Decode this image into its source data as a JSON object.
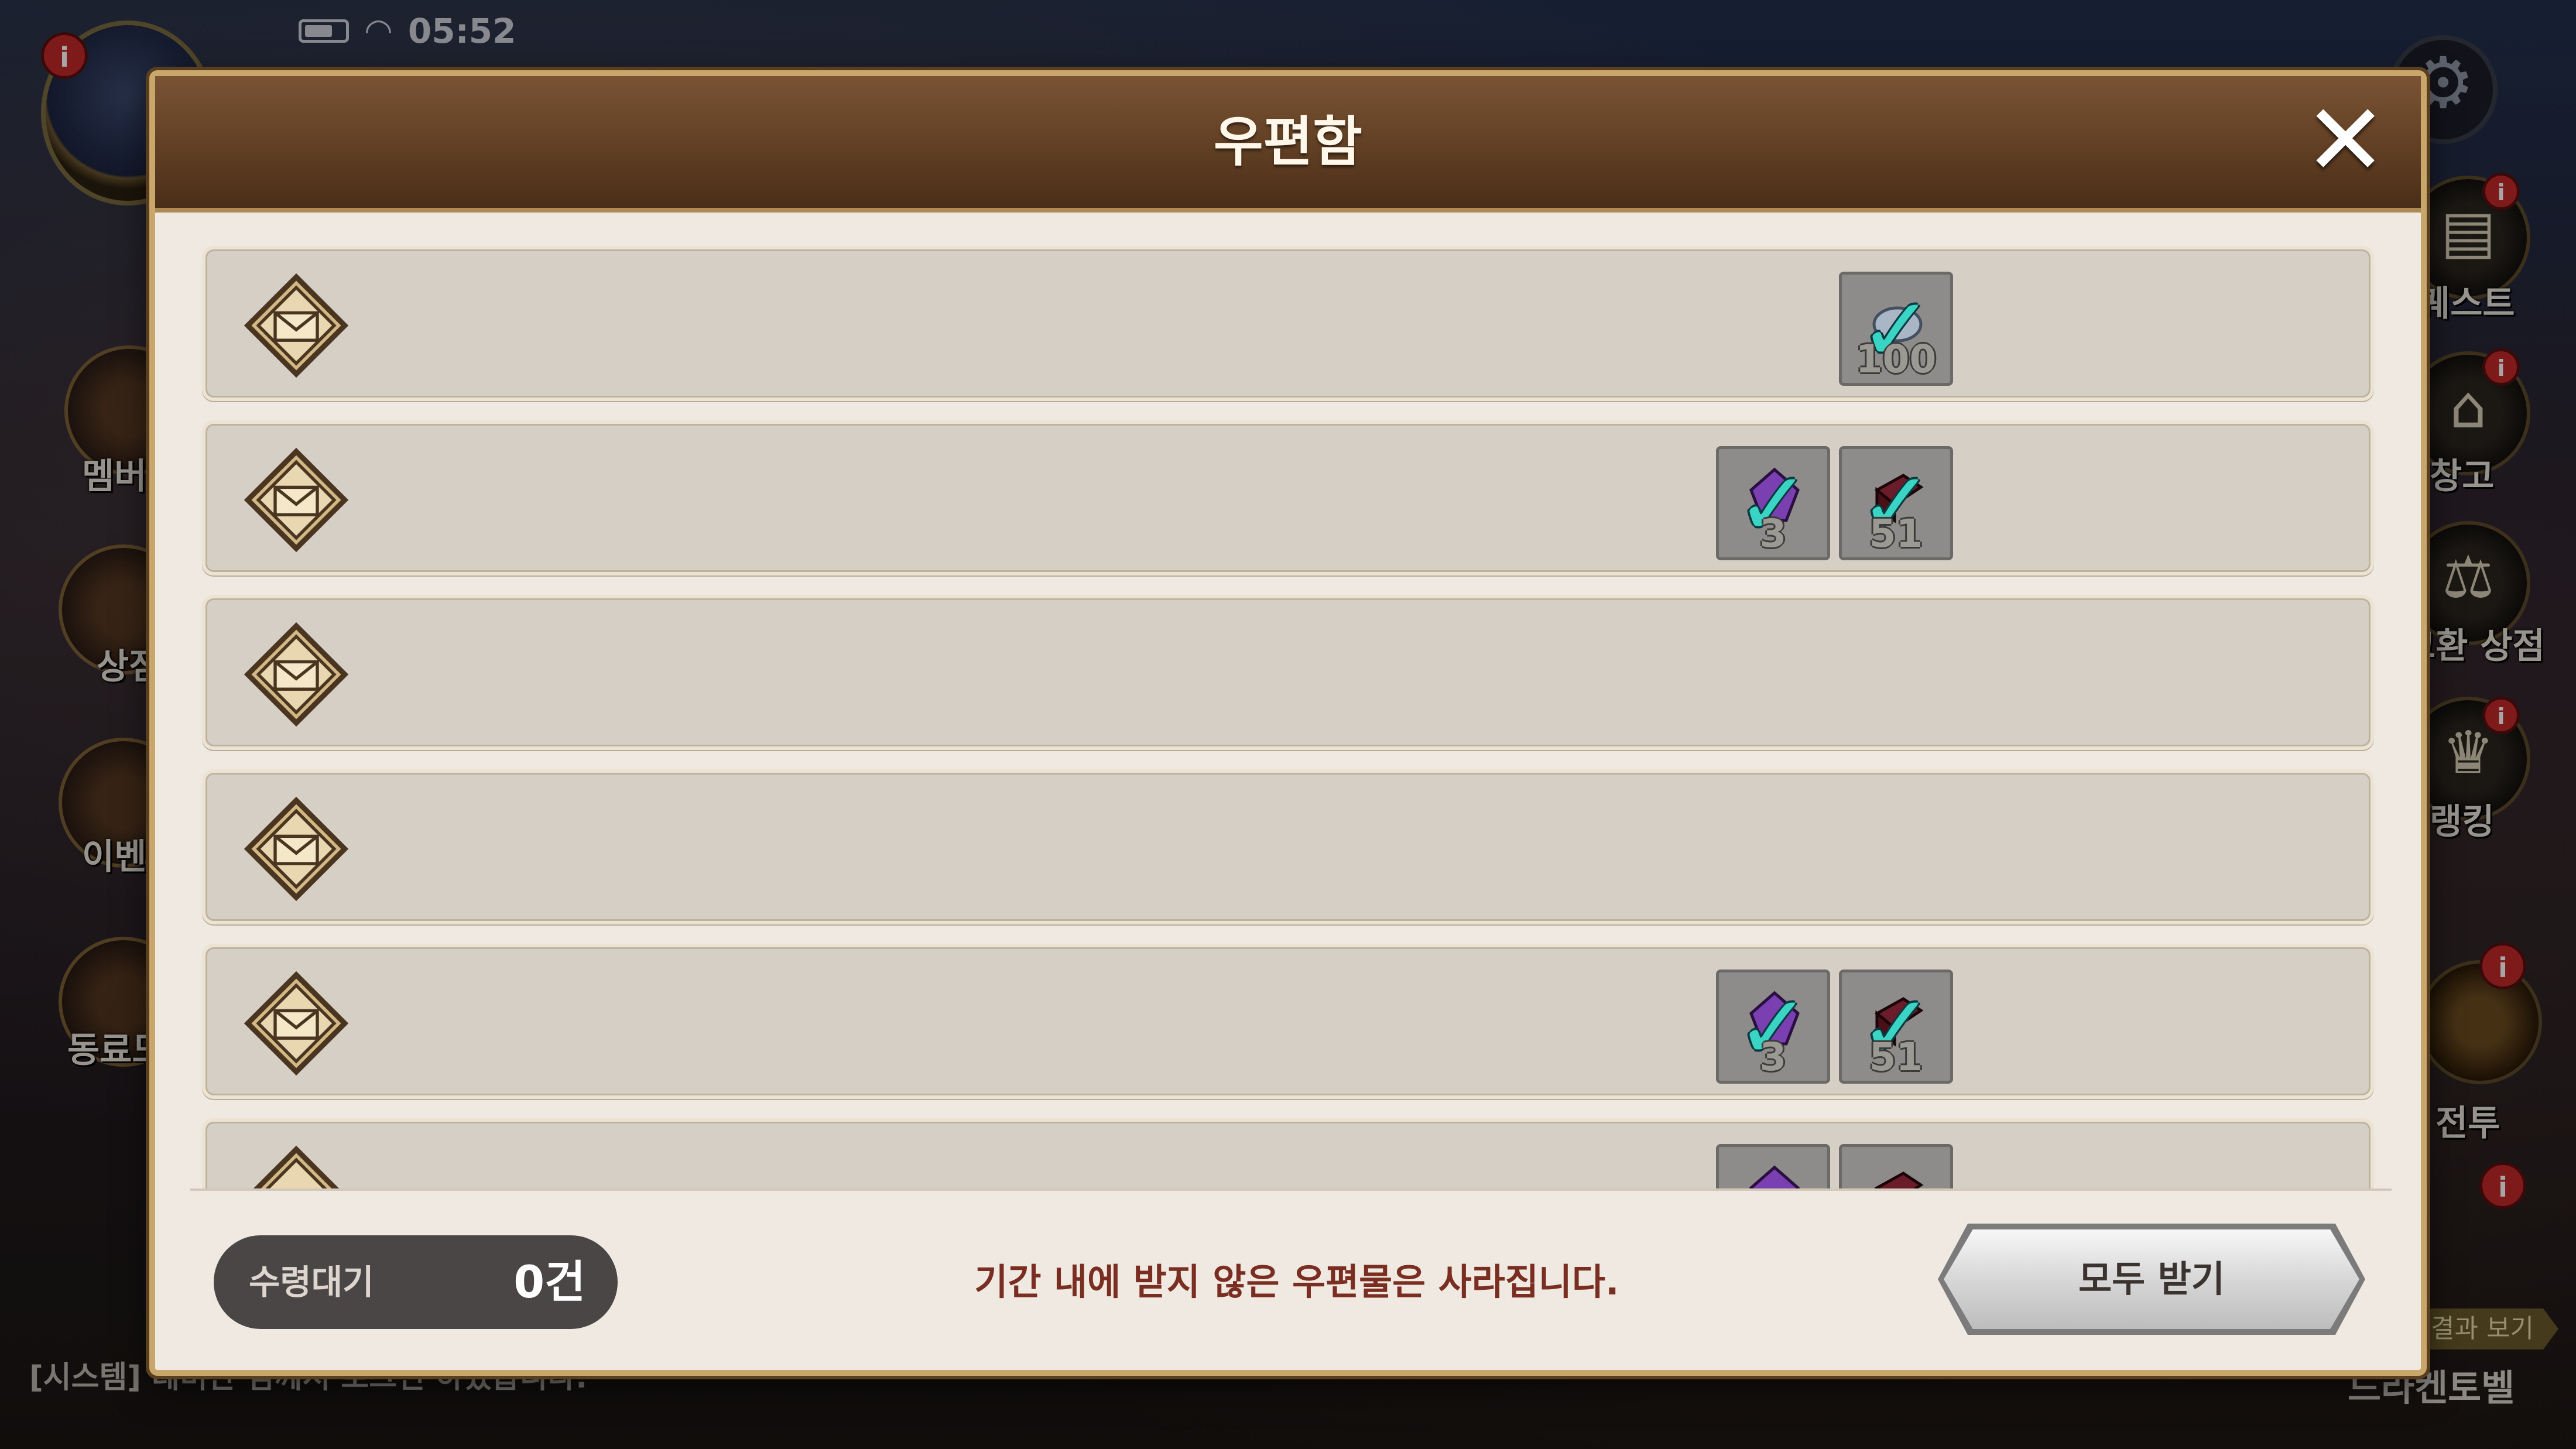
{
  "status_bar": {
    "time": "05:52"
  },
  "hud": {
    "left_menu": [
      "멤버",
      "상점",
      "이벤",
      "동료도"
    ],
    "right_menu": [
      "퀘스트",
      "창고",
      "교환 상점",
      "랭킹",
      "전투"
    ],
    "badge_text": "i",
    "chat_line": "[시스템] 데미안 님께서 로그인 하셨습니다.",
    "bottom_right_button": "결과 보기",
    "bottom_right_text": "드라켄토벨"
  },
  "mailbox": {
    "title": "우편함",
    "close_icon": "close-icon",
    "rows": [
      {
        "rewards": [
          {
            "item": "silver-ore-icon",
            "quantity": "100",
            "claimed": true
          }
        ]
      },
      {
        "rewards": [
          {
            "item": "purple-gem-icon",
            "quantity": "3",
            "claimed": true
          },
          {
            "item": "dark-red-box-icon",
            "quantity": "51",
            "claimed": true
          }
        ]
      },
      {
        "rewards": []
      },
      {
        "rewards": []
      },
      {
        "rewards": [
          {
            "item": "purple-gem-icon",
            "quantity": "3",
            "claimed": true
          },
          {
            "item": "dark-red-box-icon",
            "quantity": "51",
            "claimed": true
          }
        ]
      },
      {
        "rewards": [
          {
            "item": "purple-gem-icon",
            "quantity": "",
            "claimed": false
          },
          {
            "item": "dark-red-box-icon",
            "quantity": "",
            "claimed": false
          }
        ]
      }
    ],
    "footer": {
      "pending_label": "수령대기",
      "pending_count": "0건",
      "notice": "기간 내에 받지 않은 우편물은 사라집니다.",
      "receive_all": "모두 받기"
    }
  },
  "colors": {
    "header_brown": "#5e3d22",
    "row_bg": "#d5cfc6",
    "check_teal": "#3ad4c4",
    "notice_red": "#7a2e22",
    "pill_bg": "#4b4646"
  }
}
